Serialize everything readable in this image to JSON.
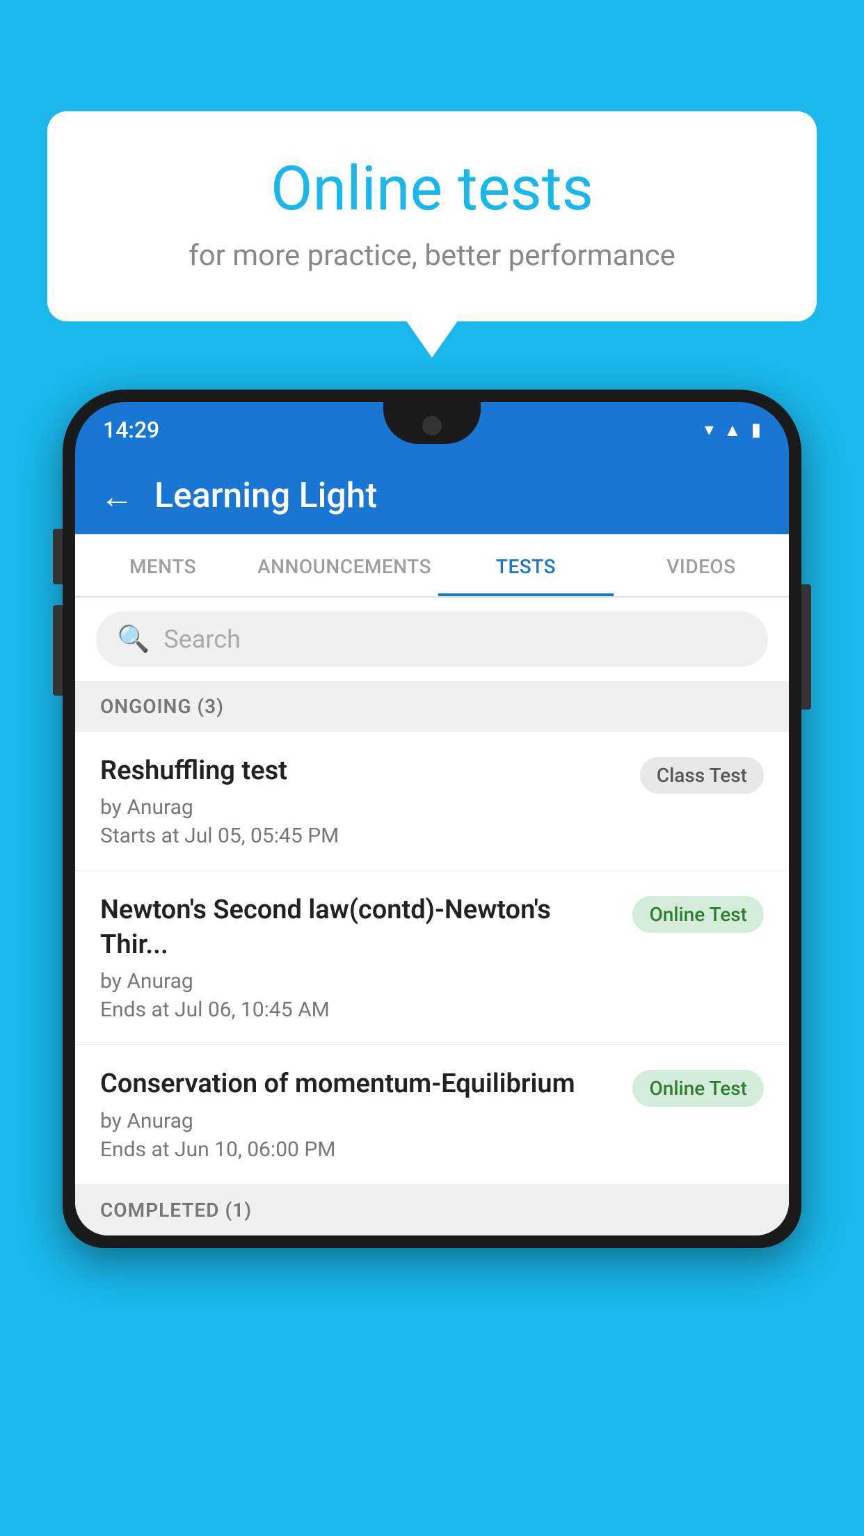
{
  "background_color": "#1ab7ea",
  "bubble": {
    "title": "Online tests",
    "subtitle": "for more practice, better performance"
  },
  "phone": {
    "status": {
      "time": "14:29",
      "icons": [
        "wifi",
        "signal",
        "battery"
      ]
    },
    "app_bar": {
      "back_label": "←",
      "title": "Learning Light"
    },
    "tabs": [
      {
        "label": "MENTS",
        "active": false
      },
      {
        "label": "ANNOUNCEMENTS",
        "active": false
      },
      {
        "label": "TESTS",
        "active": true
      },
      {
        "label": "VIDEOS",
        "active": false
      }
    ],
    "search": {
      "placeholder": "Search"
    },
    "section_ongoing": {
      "label": "ONGOING (3)"
    },
    "tests": [
      {
        "title": "Reshuffling test",
        "author": "by Anurag",
        "date": "Starts at  Jul 05, 05:45 PM",
        "badge": "Class Test",
        "badge_type": "class"
      },
      {
        "title": "Newton's Second law(contd)-Newton's Thir...",
        "author": "by Anurag",
        "date": "Ends at  Jul 06, 10:45 AM",
        "badge": "Online Test",
        "badge_type": "online"
      },
      {
        "title": "Conservation of momentum-Equilibrium",
        "author": "by Anurag",
        "date": "Ends at  Jun 10, 06:00 PM",
        "badge": "Online Test",
        "badge_type": "online"
      }
    ],
    "section_completed": {
      "label": "COMPLETED (1)"
    }
  }
}
